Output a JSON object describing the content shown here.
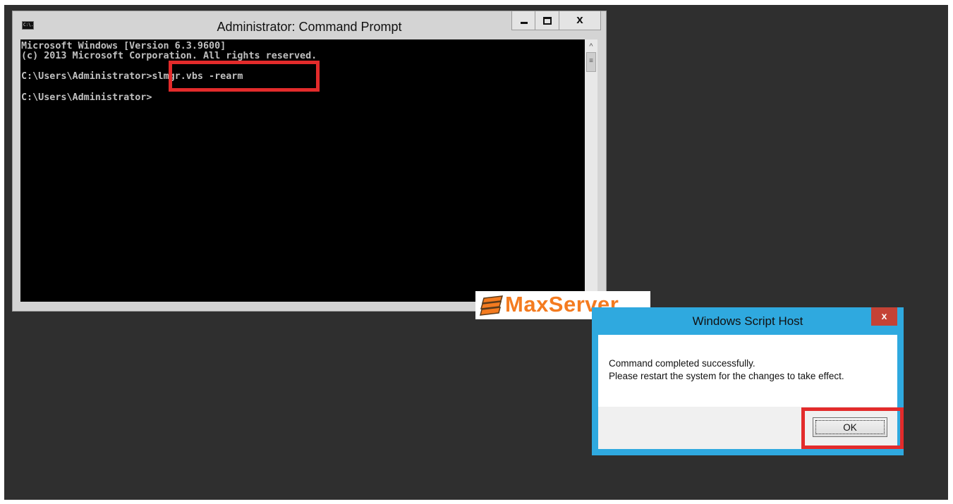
{
  "cmd_window": {
    "title": "Administrator: Command Prompt",
    "icon": "console-icon",
    "icon_label": "C:\\.",
    "console_lines": [
      "Microsoft Windows [Version 6.3.9600]",
      "(c) 2013 Microsoft Corporation. All rights reserved.",
      "",
      "C:\\Users\\Administrator>slmgr.vbs -rearm",
      "",
      "C:\\Users\\Administrator>"
    ],
    "console_background": "#000000",
    "console_text_color": "#c0c0c0"
  },
  "watermark": {
    "text": "MaxServer",
    "color": "#f47b20"
  },
  "dialog": {
    "title": "Windows Script Host",
    "message_lines": [
      "Command completed successfully.",
      "Please restart the system for the changes to take effect."
    ],
    "ok_label": "OK",
    "close_label": "x",
    "frame_color": "#2fa9df",
    "close_color": "#c44235"
  },
  "highlight_color": "#e32b2b",
  "desktop_color": "#2f2f2f"
}
